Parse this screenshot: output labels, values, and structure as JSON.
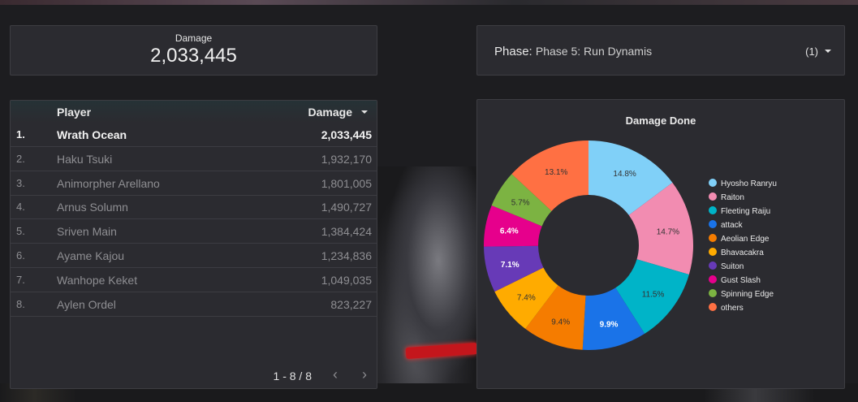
{
  "scorecard": {
    "label": "Damage",
    "value": "2,033,445"
  },
  "filter": {
    "name": "Phase",
    "value": "Phase 5: Run Dynamis",
    "count": "(1)"
  },
  "table": {
    "headers": {
      "player": "Player",
      "damage": "Damage"
    },
    "rows": [
      {
        "rank": "1.",
        "player": "Wrath Ocean",
        "damage": "2,033,445"
      },
      {
        "rank": "2.",
        "player": "Haku Tsuki",
        "damage": "1,932,170"
      },
      {
        "rank": "3.",
        "player": "Animorpher Arellano",
        "damage": "1,801,005"
      },
      {
        "rank": "4.",
        "player": "Arnus Solumn",
        "damage": "1,490,727"
      },
      {
        "rank": "5.",
        "player": "Sriven Main",
        "damage": "1,384,424"
      },
      {
        "rank": "6.",
        "player": "Ayame Kajou",
        "damage": "1,234,836"
      },
      {
        "rank": "7.",
        "player": "Wanhope Keket",
        "damage": "1,049,035"
      },
      {
        "rank": "8.",
        "player": "Aylen Ordel",
        "damage": "823,227"
      }
    ],
    "pagination": "1 - 8 / 8",
    "prev_icon": "chevron-left-icon",
    "next_icon": "chevron-right-icon"
  },
  "chart_data": {
    "type": "pie",
    "donut": true,
    "title": "Damage Done",
    "legend_position": "right",
    "categories": [
      "Hyosho Ranryu",
      "Raiton",
      "Fleeting Raiju",
      "attack",
      "Aeolian Edge",
      "Bhavacakra",
      "Suiton",
      "Gust Slash",
      "Spinning Edge",
      "others"
    ],
    "values": [
      14.8,
      14.7,
      11.5,
      9.9,
      9.4,
      7.4,
      7.1,
      6.4,
      5.7,
      13.1
    ],
    "labels": [
      "14.8%",
      "14.7%",
      "11.5%",
      "9.9%",
      "9.4%",
      "7.4%",
      "7.1%",
      "6.4%",
      "5.7%",
      "13.1%"
    ],
    "colors": [
      "#80d0f8",
      "#f28cb1",
      "#00b4c8",
      "#1a73e8",
      "#f57c00",
      "#ffab00",
      "#673ab7",
      "#e6008c",
      "#7cb342",
      "#ff7043"
    ],
    "label_colors": [
      "#333333",
      "#333333",
      "#333333",
      "#ffffff",
      "#333333",
      "#333333",
      "#ffffff",
      "#ffffff",
      "#333333",
      "#333333"
    ]
  }
}
